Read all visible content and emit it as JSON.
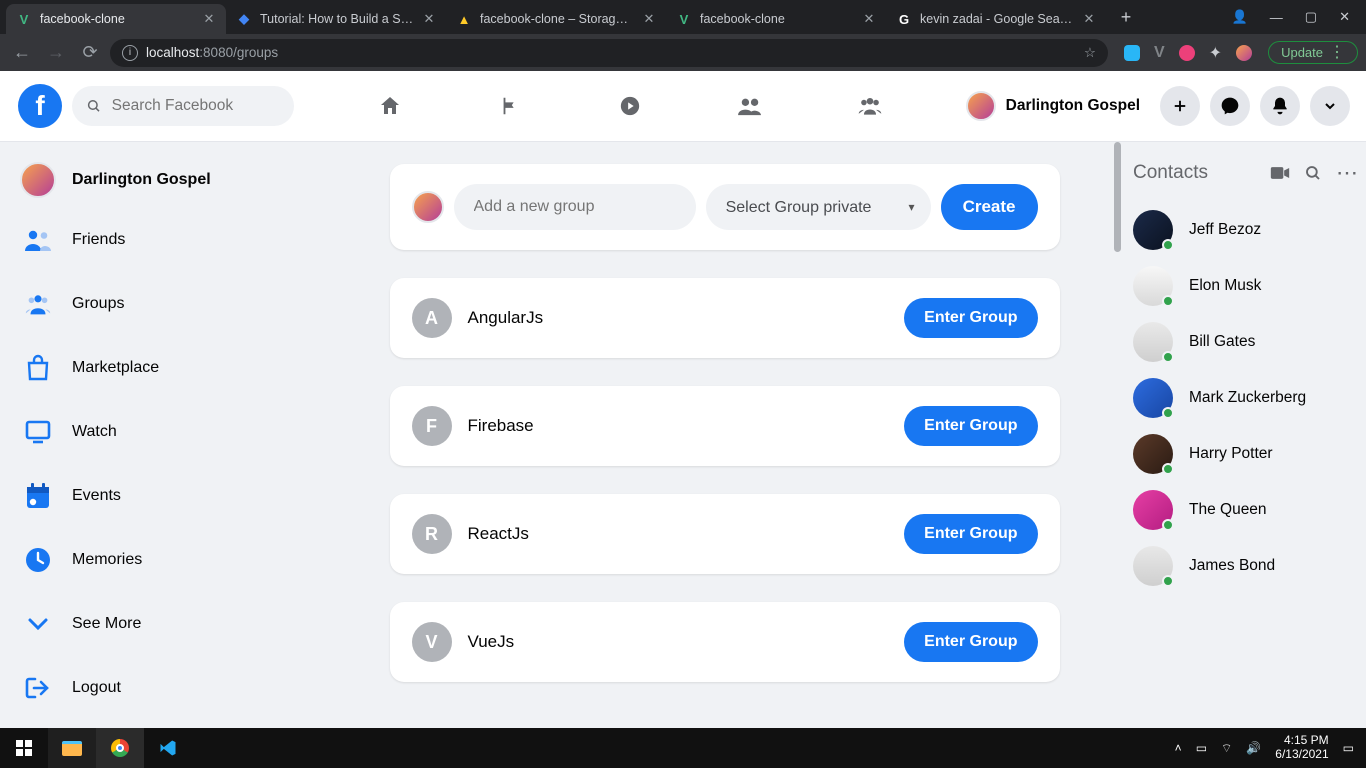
{
  "browser": {
    "tabs": [
      {
        "title": "facebook-clone",
        "favicon": "V",
        "favicon_color": "#41b883",
        "active": true
      },
      {
        "title": "Tutorial: How to Build a Socia",
        "favicon": "◆",
        "favicon_color": "#4285f4",
        "active": false
      },
      {
        "title": "facebook-clone – Storage – F",
        "favicon": "▲",
        "favicon_color": "#ffca28",
        "active": false
      },
      {
        "title": "facebook-clone",
        "favicon": "V",
        "favicon_color": "#41b883",
        "active": false
      },
      {
        "title": "kevin zadai - Google Search",
        "favicon": "G",
        "favicon_color": "#ffffff",
        "active": false
      }
    ],
    "url_host": "localhost",
    "url_path": ":8080/groups",
    "update_label": "Update"
  },
  "topbar": {
    "search_placeholder": "Search Facebook",
    "user_name": "Darlington Gospel",
    "center_icons": [
      "home",
      "flag",
      "play",
      "friends",
      "groups"
    ]
  },
  "sidebar": {
    "user_name": "Darlington Gospel",
    "items": [
      {
        "label": "Friends",
        "icon": "friends"
      },
      {
        "label": "Groups",
        "icon": "groups"
      },
      {
        "label": "Marketplace",
        "icon": "bag"
      },
      {
        "label": "Watch",
        "icon": "monitor"
      },
      {
        "label": "Events",
        "icon": "calendar"
      },
      {
        "label": "Memories",
        "icon": "clock"
      },
      {
        "label": "See More",
        "icon": "chevron"
      },
      {
        "label": "Logout",
        "icon": "logout"
      }
    ]
  },
  "create": {
    "input_placeholder": "Add a new group",
    "select_label": "Select Group private",
    "button_label": "Create"
  },
  "groups": [
    {
      "initial": "A",
      "name": "AngularJs",
      "action": "Enter Group"
    },
    {
      "initial": "F",
      "name": "Firebase",
      "action": "Enter Group"
    },
    {
      "initial": "R",
      "name": "ReactJs",
      "action": "Enter Group"
    },
    {
      "initial": "V",
      "name": "VueJs",
      "action": "Enter Group"
    }
  ],
  "contacts": {
    "heading": "Contacts",
    "list": [
      {
        "name": "Jeff Bezoz"
      },
      {
        "name": "Elon Musk"
      },
      {
        "name": "Bill Gates"
      },
      {
        "name": "Mark Zuckerberg"
      },
      {
        "name": "Harry Potter"
      },
      {
        "name": "The Queen"
      },
      {
        "name": "James Bond"
      }
    ]
  },
  "taskbar": {
    "time": "4:15 PM",
    "date": "6/13/2021"
  },
  "contact_bg": [
    "linear-gradient(135deg,#1b2a49,#0b1220)",
    "linear-gradient(180deg,#f7f7f7,#d9d9d9)",
    "linear-gradient(180deg,#e9e9e9,#cfcfcf)",
    "linear-gradient(135deg,#2d6cdf,#1846a3)",
    "linear-gradient(135deg,#5b3a29,#2a1b13)",
    "linear-gradient(135deg,#e63fa4,#b41d82)",
    "linear-gradient(180deg,#e8e8e8,#cfcfcf)"
  ]
}
